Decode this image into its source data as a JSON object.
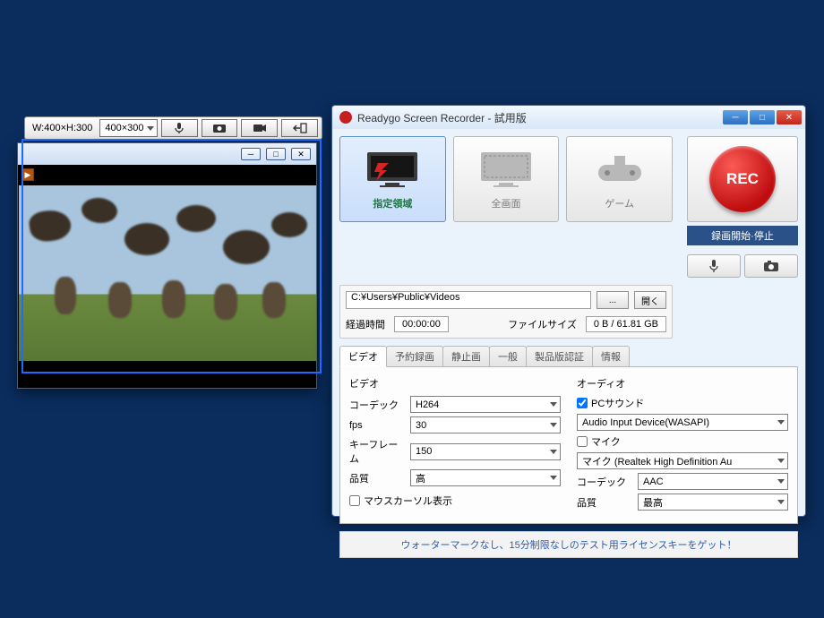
{
  "captureToolbar": {
    "sizeLabel": "W:400×H:300",
    "sizeDropdown": "400×300"
  },
  "app": {
    "title": "Readygo Screen Recorder - 試用版",
    "modes": [
      {
        "label": "指定領域"
      },
      {
        "label": "全画面"
      },
      {
        "label": "ゲーム"
      }
    ],
    "recText": "REC",
    "recLabel": "録画開始·停止",
    "path": "C:¥Users¥Public¥Videos",
    "browseBtn": "...",
    "openBtn": "開く",
    "elapsedLabel": "経過時間",
    "elapsedValue": "00:00:00",
    "fileSizeLabel": "ファイルサイズ",
    "fileSizeValue": "0 B / 61.81 GB",
    "tabs": [
      "ビデオ",
      "予約録画",
      "静止画",
      "一般",
      "製品版認証",
      "情報"
    ],
    "videoSection": {
      "heading": "ビデオ",
      "codecLabel": "コーデック",
      "codecValue": "H264",
      "fpsLabel": "fps",
      "fpsValue": "30",
      "keyframeLabel": "キーフレーム",
      "keyframeValue": "150",
      "qualityLabel": "品質",
      "qualityValue": "高",
      "cursorLabel": "マウスカーソル表示"
    },
    "audioSection": {
      "heading": "オーディオ",
      "pcSoundLabel": "PCサウンド",
      "pcSoundDevice": "Audio Input Device(WASAPI)",
      "micLabel": "マイク",
      "micDevice": "マイク (Realtek High Definition Au",
      "codecLabel": "コーデック",
      "codecValue": "AAC",
      "qualityLabel": "品質",
      "qualityValue": "最高"
    },
    "footer": "ウォーターマークなし、15分制限なしのテスト用ライセンスキーをゲット！"
  }
}
